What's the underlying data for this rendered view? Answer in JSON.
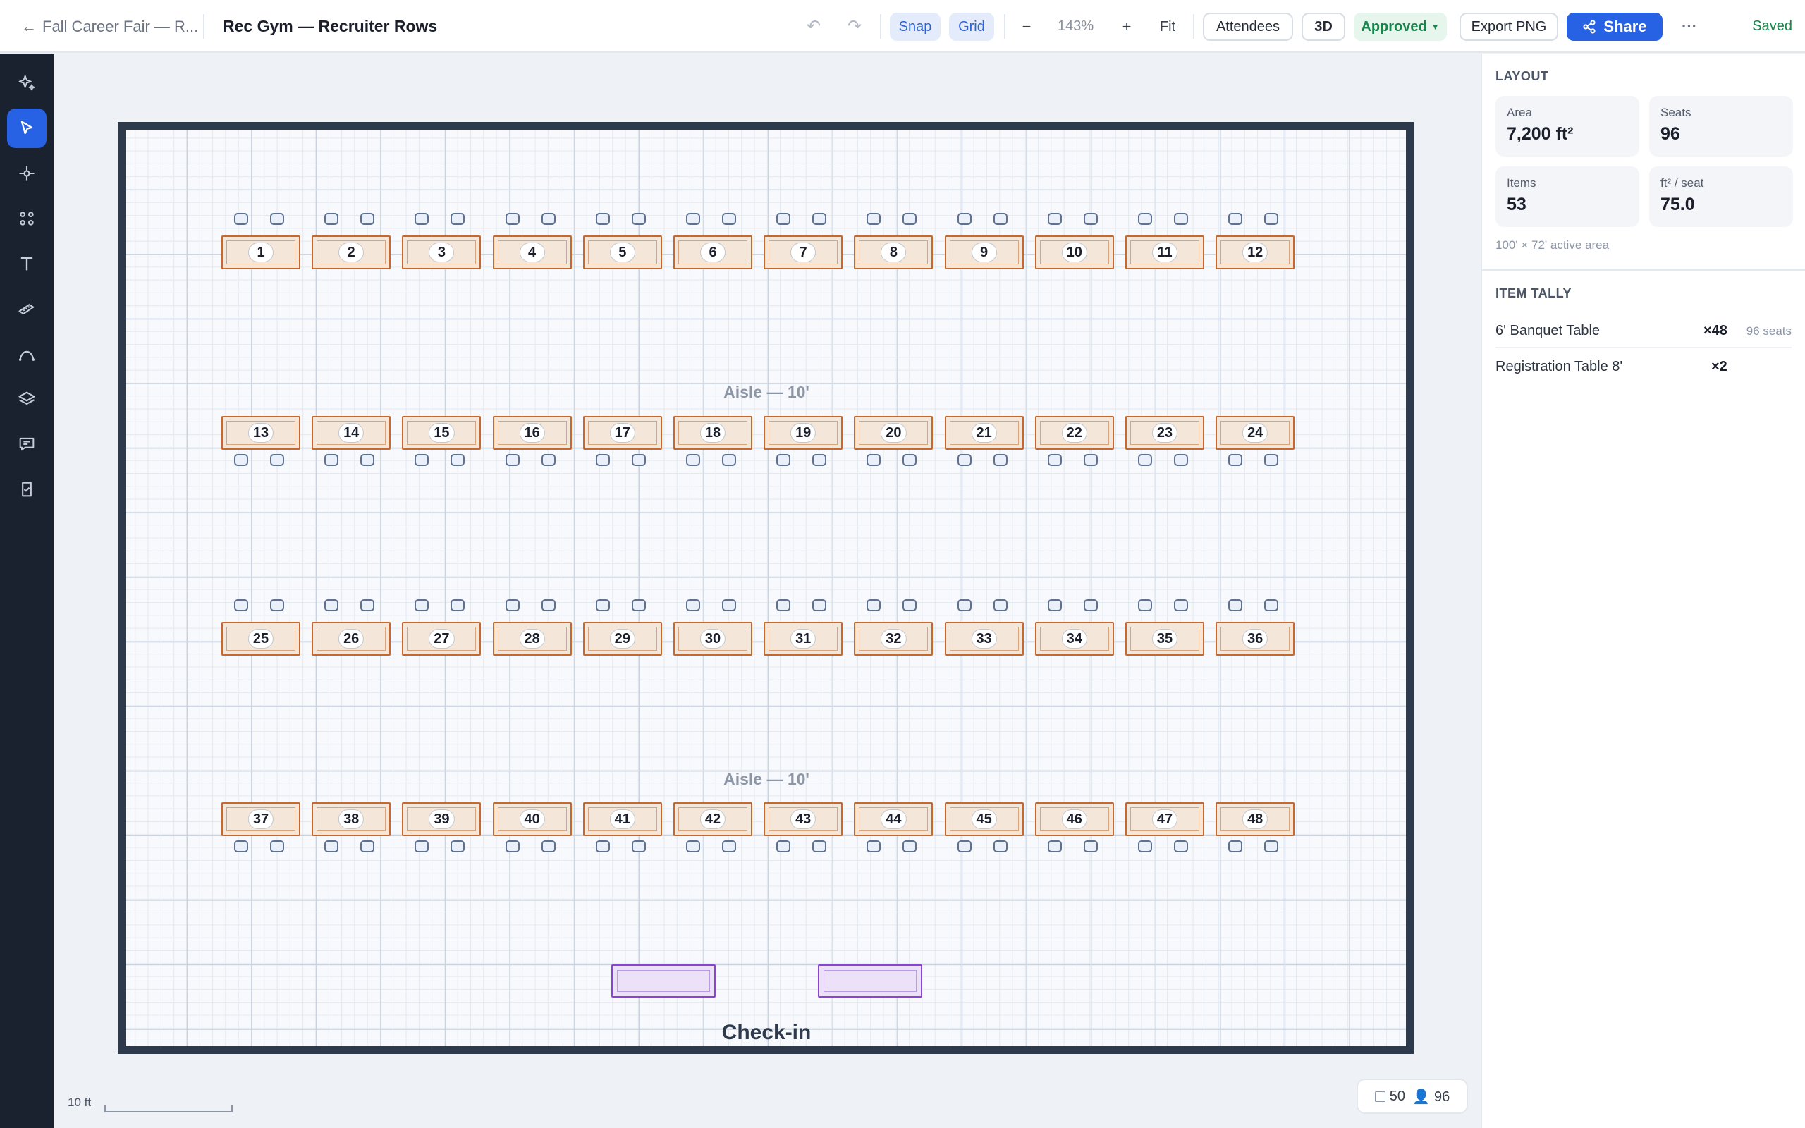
{
  "header": {
    "back_label": "Fall Career Fair — R...",
    "title": "Rec Gym — Recruiter Rows",
    "undo_icon": "undo-icon",
    "redo_icon": "redo-icon",
    "snap_label": "Snap",
    "grid_label": "Grid",
    "zoom_out_label": "−",
    "zoom_value": "143%",
    "zoom_in_label": "+",
    "fit_label": "Fit",
    "attendees_label": "Attendees",
    "view3d_label": "3D",
    "status_label": "Approved",
    "export_label": "Export PNG",
    "share_label": "Share",
    "more_label": "···",
    "saved_label": "Saved"
  },
  "toolbar": {
    "tools": [
      {
        "name": "ai-sparkle-icon",
        "active": false
      },
      {
        "name": "select-pointer-icon",
        "active": true
      },
      {
        "name": "move-node-icon",
        "active": false
      },
      {
        "name": "components-icon",
        "active": false
      },
      {
        "name": "text-tool-icon",
        "active": false
      },
      {
        "name": "measure-ruler-icon",
        "active": false
      },
      {
        "name": "curve-pen-icon",
        "active": false
      },
      {
        "name": "layers-icon",
        "active": false
      },
      {
        "name": "comments-icon",
        "active": false
      },
      {
        "name": "checklist-icon",
        "active": false
      }
    ]
  },
  "floorplan": {
    "table_numbers": [
      [
        "1",
        "2",
        "3",
        "4",
        "5",
        "6",
        "7",
        "8",
        "9",
        "10",
        "11",
        "12"
      ],
      [
        "13",
        "14",
        "15",
        "16",
        "17",
        "18",
        "19",
        "20",
        "21",
        "22",
        "23",
        "24"
      ],
      [
        "25",
        "26",
        "27",
        "28",
        "29",
        "30",
        "31",
        "32",
        "33",
        "34",
        "35",
        "36"
      ],
      [
        "37",
        "38",
        "39",
        "40",
        "41",
        "42",
        "43",
        "44",
        "45",
        "46",
        "47",
        "48"
      ]
    ],
    "aisle_top": "Aisle — 10'",
    "aisle_bottom": "Aisle — 10'",
    "checkin_label": "Check-in"
  },
  "status_bar": {
    "scale_label": "10 ft",
    "item_count": "50",
    "seat_count": "96"
  },
  "panel": {
    "layout_heading": "LAYOUT",
    "area_label": "Area",
    "area_value": "7,200 ft²",
    "seats_label": "Seats",
    "seats_value": "96",
    "items_label": "Items",
    "items_value": "53",
    "ratio_label": "ft² / seat",
    "ratio_value": "75.0",
    "area_note": "100' × 72' active area",
    "tally_heading": "ITEM TALLY",
    "tally": [
      {
        "name": "6' Banquet Table",
        "count": "×48",
        "seats": "96 seats"
      },
      {
        "name": "Registration Table 8'",
        "count": "×2",
        "seats": ""
      }
    ]
  },
  "colors": {
    "accent": "#2662e3",
    "approved": "#17864a",
    "banquet_table": "#c8682c",
    "registration_table": "#8a44d2",
    "room_wall": "#2d3a4c"
  }
}
